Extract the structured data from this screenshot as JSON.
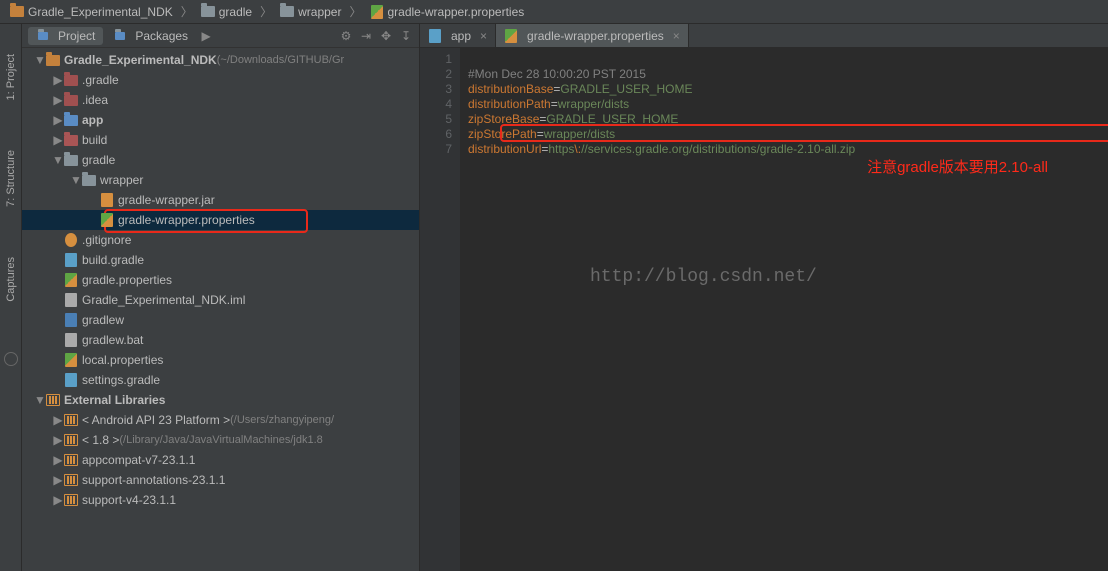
{
  "breadcrumb": [
    {
      "icon": "project",
      "label": "Gradle_Experimental_NDK"
    },
    {
      "icon": "folder",
      "label": "gradle"
    },
    {
      "icon": "folder",
      "label": "wrapper"
    },
    {
      "icon": "props",
      "label": "gradle-wrapper.properties"
    }
  ],
  "panel": {
    "tabs": [
      {
        "label": "Project",
        "active": true
      },
      {
        "label": "Packages",
        "active": false
      }
    ]
  },
  "leftRail": [
    {
      "label": "1: Project"
    },
    {
      "label": "7: Structure"
    },
    {
      "label": "Captures"
    }
  ],
  "tree": [
    {
      "indent": 0,
      "expand": "▼",
      "iconType": "folder project",
      "label": "Gradle_Experimental_NDK",
      "bold": true,
      "path": "(~/Downloads/GITHUB/Gr"
    },
    {
      "indent": 1,
      "expand": "▶",
      "iconType": "folder hidden",
      "label": ".gradle"
    },
    {
      "indent": 1,
      "expand": "▶",
      "iconType": "folder hidden",
      "label": ".idea"
    },
    {
      "indent": 1,
      "expand": "▶",
      "iconType": "folder app",
      "label": "app",
      "bold": true
    },
    {
      "indent": 1,
      "expand": "▶",
      "iconType": "folder excl",
      "label": "build"
    },
    {
      "indent": 1,
      "expand": "▼",
      "iconType": "folder",
      "label": "gradle"
    },
    {
      "indent": 2,
      "expand": "▼",
      "iconType": "folder",
      "label": "wrapper"
    },
    {
      "indent": 3,
      "expand": "",
      "iconType": "doc jar",
      "label": "gradle-wrapper.jar"
    },
    {
      "indent": 3,
      "expand": "",
      "iconType": "doc props",
      "label": "gradle-wrapper.properties",
      "selected": true,
      "highlighted": true
    },
    {
      "indent": 1,
      "expand": "",
      "iconType": "doc git",
      "label": ".gitignore"
    },
    {
      "indent": 1,
      "expand": "",
      "iconType": "doc gradle",
      "label": "build.gradle"
    },
    {
      "indent": 1,
      "expand": "",
      "iconType": "doc props",
      "label": "gradle.properties"
    },
    {
      "indent": 1,
      "expand": "",
      "iconType": "doc",
      "label": "Gradle_Experimental_NDK.iml"
    },
    {
      "indent": 1,
      "expand": "",
      "iconType": "doc sh",
      "label": "gradlew"
    },
    {
      "indent": 1,
      "expand": "",
      "iconType": "doc",
      "label": "gradlew.bat"
    },
    {
      "indent": 1,
      "expand": "",
      "iconType": "doc props",
      "label": "local.properties"
    },
    {
      "indent": 1,
      "expand": "",
      "iconType": "doc gradle",
      "label": "settings.gradle"
    },
    {
      "indent": 0,
      "expand": "▼",
      "iconType": "lib",
      "label": "External Libraries",
      "bold": true
    },
    {
      "indent": 1,
      "expand": "▶",
      "iconType": "lib",
      "label": "< Android API 23 Platform >",
      "path": "(/Users/zhangyipeng/"
    },
    {
      "indent": 1,
      "expand": "▶",
      "iconType": "lib",
      "label": "< 1.8 >",
      "path": "(/Library/Java/JavaVirtualMachines/jdk1.8"
    },
    {
      "indent": 1,
      "expand": "▶",
      "iconType": "lib",
      "label": "appcompat-v7-23.1.1"
    },
    {
      "indent": 1,
      "expand": "▶",
      "iconType": "lib",
      "label": "support-annotations-23.1.1"
    },
    {
      "indent": 1,
      "expand": "▶",
      "iconType": "lib",
      "label": "support-v4-23.1.1"
    }
  ],
  "editorTabs": [
    {
      "icon": "gradle",
      "label": "app",
      "active": false
    },
    {
      "icon": "props",
      "label": "gradle-wrapper.properties",
      "active": true
    }
  ],
  "code": {
    "lines": [
      "1",
      "2",
      "3",
      "4",
      "5",
      "6",
      "7"
    ],
    "l1": "#Mon Dec 28 10:00:20 PST 2015",
    "l2k": "distributionBase",
    "l2v": "GRADLE_USER_HOME",
    "l3k": "distributionPath",
    "l3v": "wrapper/dists",
    "l4k": "zipStoreBase",
    "l4v": "GRADLE_USER_HOME",
    "l5k": "zipStorePath",
    "l5v": "wrapper/dists",
    "l6k": "distributionUrl",
    "l6v1": "https",
    "l6esc": "\\:",
    "l6v2": "//services.gradle.org/distributions/gradle-2.10-all.zip"
  },
  "annotation": "注意gradle版本要用2.10-all",
  "watermark": "http://blog.csdn.net/"
}
